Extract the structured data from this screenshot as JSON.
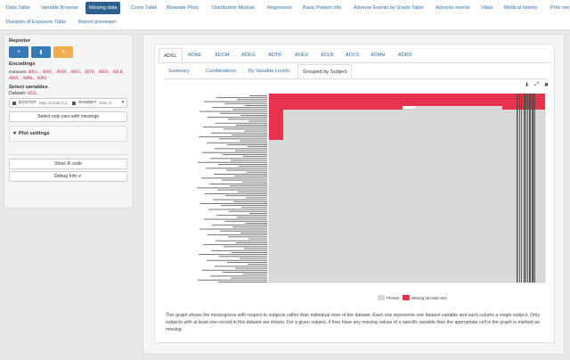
{
  "nav": {
    "row1": [
      "Data Table",
      "Variable Browser",
      "Missing data",
      "Cross Table",
      "Bivariate Plots",
      "Distribution Module",
      "Regression",
      "Basic Patient info",
      "Adverse Events by Grade Table",
      "Adverse events",
      "Vitals",
      "Medical history",
      "Prior me"
    ],
    "row2": [
      "Duration of Exposure Table",
      "Report previewer"
    ],
    "active": "Missing data"
  },
  "sidebar": {
    "reporter_label": "Reporter",
    "reporter_buttons": [
      "+",
      "⬇",
      "×"
    ],
    "encodings_label": "Encodings",
    "datasets_label": "Datasets:",
    "datasets_value": "ADSL, ADAE, ADCM, ADEG, ADTR, ADEX, ADLB, ADVS, ADMH, ADRS",
    "select_variables_label": "Select variables",
    "dataset_label": "Dataset:",
    "dataset_value": "ADSL",
    "selected_vars": [
      {
        "name": "DCUTDT",
        "desc": "Date of Data Cut..."
      },
      {
        "name": "RANDDT",
        "desc": "Date of ..."
      }
    ],
    "only_missings_button": "Select only vars with missings",
    "plot_settings_label": "Plot settings",
    "show_r_code_button": "Show R code",
    "debug_info_button": "Debug Info ✔"
  },
  "dataset_tabs": [
    "ADSL",
    "ADAE",
    "ADCM",
    "ADEG",
    "ADTR",
    "ADEX",
    "ADLB",
    "ADVS",
    "ADMH",
    "ADRS"
  ],
  "active_dataset_tab": "ADSL",
  "view_tabs": [
    "Summary",
    "Combinations",
    "By Variable Levels",
    "Grouped by Subject"
  ],
  "active_view_tab": "Grouped by Subject",
  "tools": {
    "download_icon": "⬇",
    "expand_icon": "⤢",
    "close_icon": "✖"
  },
  "chart_data": {
    "type": "heatmap",
    "legend": [
      {
        "label": "Present",
        "color": "#d9d9d9"
      },
      {
        "label": "Missing (at least one)",
        "color": "#e8334f"
      }
    ],
    "colors": {
      "present": "#d9d9d9",
      "missing": "#e8334f"
    }
  },
  "description": "This graph shows the missingness with respect to subjects rather than individual rows of the dataset. Each row represents one dataset variable and each column a single subject. Only subjects with at least one record in this dataset are shown. For a given subject, if they have any missing values of a specific variable then the appropriate cell in the graph is marked as missing."
}
